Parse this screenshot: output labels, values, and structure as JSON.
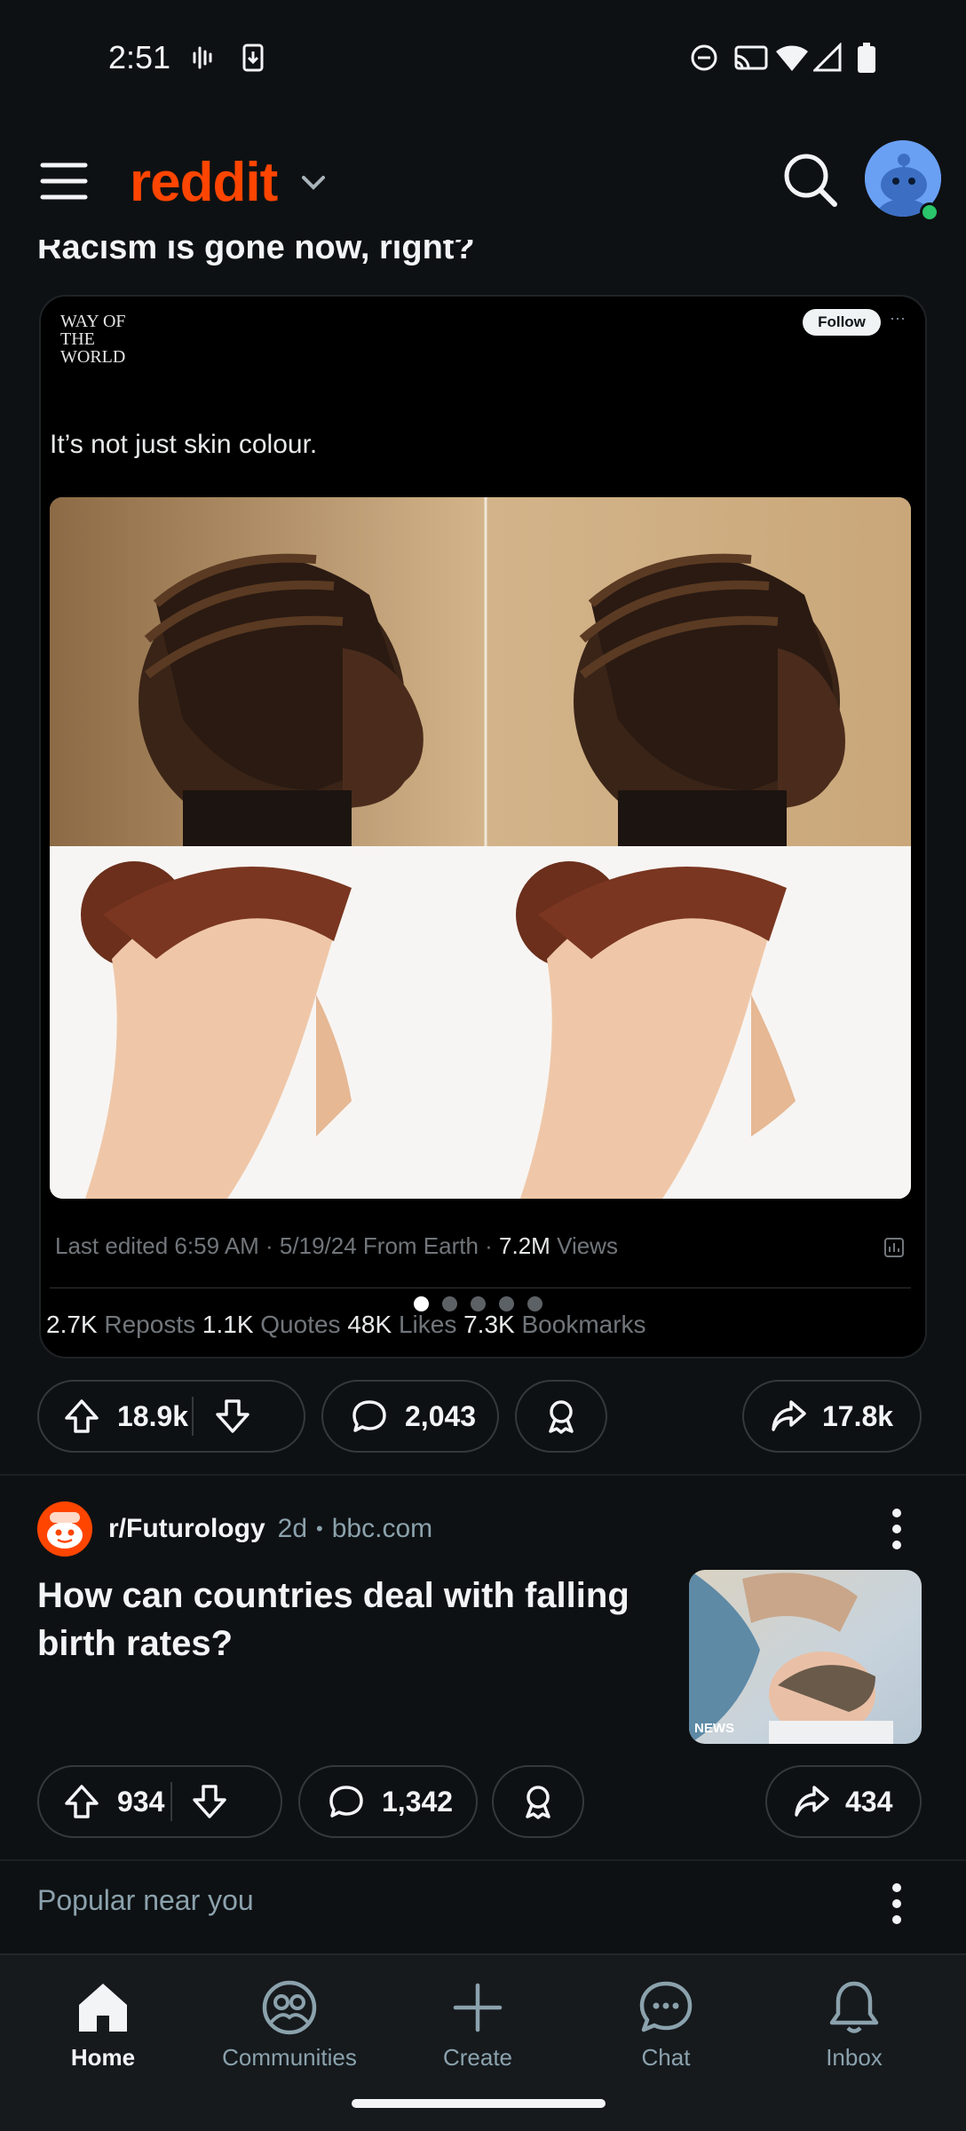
{
  "status_bar": {
    "time": "2:51"
  },
  "header": {
    "logo": "reddit"
  },
  "post1": {
    "title": "Racism is gone now, right?",
    "embed": {
      "source_logo": "WAY OF THE WORLD",
      "follow_label": "Follow",
      "more": "···",
      "text": "It’s not just skin colour.",
      "meta_prefix": "Last edited 6:59 AM · 5/19/24 From Earth · ",
      "views_count": "7.2M",
      "views_label": " Views",
      "stats": [
        {
          "count": "2.7K",
          "label": " Reposts "
        },
        {
          "count": "1.1K",
          "label": " Quotes "
        },
        {
          "count": "48K",
          "label": " Likes "
        },
        {
          "count": "7.3K",
          "label": " Bookmarks"
        }
      ],
      "carousel": {
        "total": 5,
        "active": 1
      }
    },
    "actions": {
      "upvotes": "18.9k",
      "comments": "2,043",
      "shares": "17.8k"
    }
  },
  "post2": {
    "subreddit": "r/Futurology",
    "age": "2d",
    "bullet": "•",
    "domain": "bbc.com",
    "title": "How can countries deal with falling birth rates?",
    "thumb_tag": "NEWS",
    "actions": {
      "upvotes": "934",
      "comments": "1,342",
      "shares": "434"
    }
  },
  "popular": {
    "label": "Popular near you"
  },
  "bottom_nav": [
    {
      "label": "Home",
      "icon": "home-icon",
      "active": true
    },
    {
      "label": "Communities",
      "icon": "communities-icon",
      "active": false
    },
    {
      "label": "Create",
      "icon": "plus-icon",
      "active": false
    },
    {
      "label": "Chat",
      "icon": "chat-icon",
      "active": false
    },
    {
      "label": "Inbox",
      "icon": "bell-icon",
      "active": false
    }
  ],
  "colors": {
    "brand": "#ff4500",
    "background": "#0e1113",
    "pill_border": "#33393d"
  }
}
